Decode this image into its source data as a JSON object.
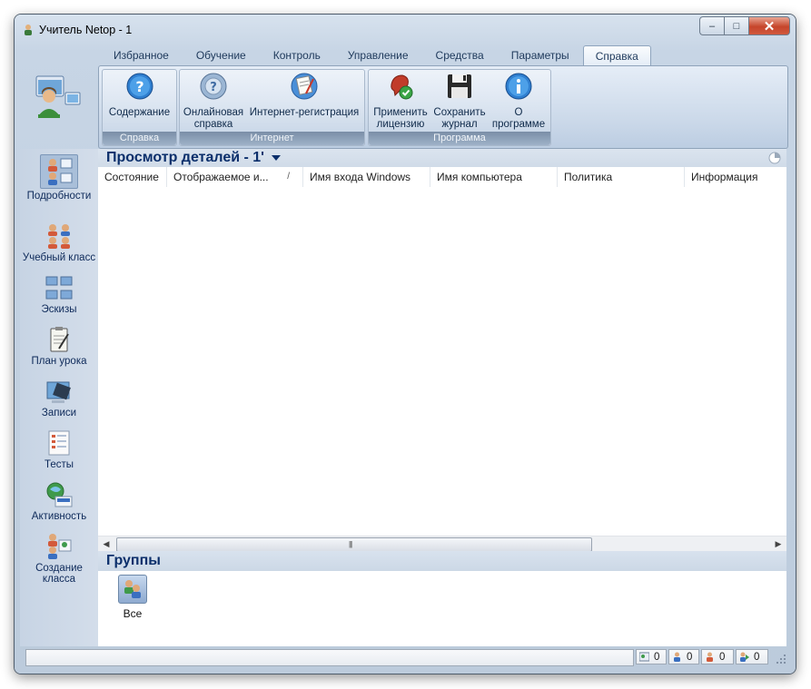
{
  "window": {
    "title": "Учитель Netop - 1"
  },
  "caption_buttons": {
    "minimize": "–",
    "maximize": "□",
    "close": "✕"
  },
  "ribbon": {
    "tabs": [
      "Избранное",
      "Обучение",
      "Контроль",
      "Управление",
      "Средства",
      "Параметры",
      "Справка"
    ],
    "active_tab": "Справка",
    "groups": {
      "help": {
        "label": "Справка",
        "buttons": {
          "contents": "Содержание"
        }
      },
      "internet": {
        "label": "Интернет",
        "buttons": {
          "online_help_1": "Онлайновая",
          "online_help_2": "справка",
          "registration": "Интернет-регистрация"
        }
      },
      "program": {
        "label": "Программа",
        "buttons": {
          "apply_license_1": "Применить",
          "apply_license_2": "лицензию",
          "save_log_1": "Сохранить",
          "save_log_2": "журнал",
          "about_1": "О",
          "about_2": "программе"
        }
      }
    }
  },
  "sidebar": {
    "items": [
      {
        "label": "Подробности",
        "icon": "details-icon",
        "selected": true
      },
      {
        "label": "Учебный класс",
        "icon": "classroom-icon",
        "selected": false
      },
      {
        "label": "Эскизы",
        "icon": "thumbnails-icon",
        "selected": false
      },
      {
        "label": "План урока",
        "icon": "lesson-plan-icon",
        "selected": false
      },
      {
        "label": "Записи",
        "icon": "recordings-icon",
        "selected": false
      },
      {
        "label": "Тесты",
        "icon": "tests-icon",
        "selected": false
      },
      {
        "label": "Активность",
        "icon": "activity-icon",
        "selected": false
      },
      {
        "label": "Создание класса",
        "icon": "create-class-icon",
        "selected": false
      }
    ]
  },
  "details_view": {
    "title": "Просмотр деталей - 1'",
    "columns": [
      "Состояние",
      "Отображаемое и...",
      "Имя входа Windows",
      "Имя компьютера",
      "Политика",
      "Информация"
    ],
    "sort_indicator": "/",
    "rows": []
  },
  "groups": {
    "title": "Группы",
    "items": [
      {
        "label": "Все",
        "icon": "all-students-icon"
      }
    ]
  },
  "status_bar": {
    "text": "",
    "counters": [
      {
        "icon": "computers-count-icon",
        "value": "0"
      },
      {
        "icon": "students-count-icon",
        "value": "0"
      },
      {
        "icon": "hand-raised-count-icon",
        "value": "0"
      },
      {
        "icon": "active-count-icon",
        "value": "0"
      }
    ]
  },
  "colors": {
    "accent_title": "#0b2f6b",
    "ribbon_bg": "#c9d7e8",
    "close_red": "#c6452b"
  }
}
